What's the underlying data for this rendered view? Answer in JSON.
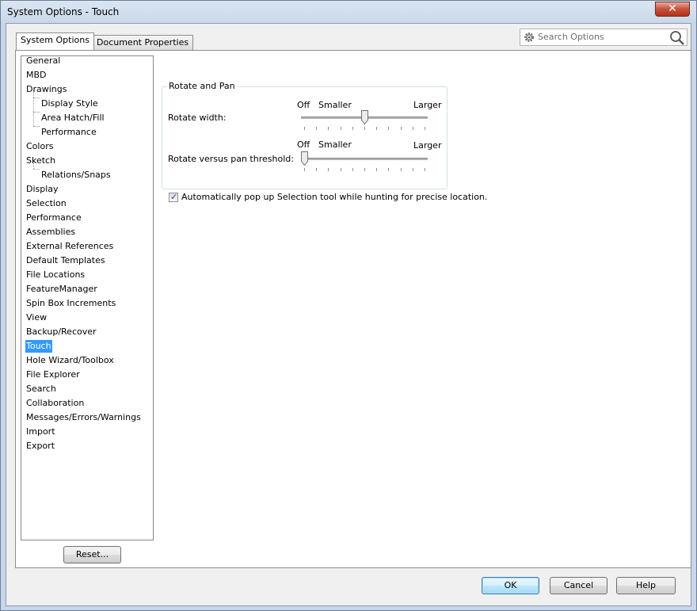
{
  "window": {
    "title": "System Options - Touch",
    "close_glyph": "✕"
  },
  "tabs": [
    {
      "label": "System Options",
      "active": true
    },
    {
      "label": "Document Properties",
      "active": false
    }
  ],
  "search": {
    "placeholder": "Search Options"
  },
  "tree": {
    "items": [
      {
        "label": "General"
      },
      {
        "label": "MBD"
      },
      {
        "label": "Drawings"
      },
      {
        "label": "Display Style",
        "child": true
      },
      {
        "label": "Area Hatch/Fill",
        "child": true
      },
      {
        "label": "Performance",
        "child": true
      },
      {
        "label": "Colors"
      },
      {
        "label": "Sketch"
      },
      {
        "label": "Relations/Snaps",
        "child": true
      },
      {
        "label": "Display"
      },
      {
        "label": "Selection"
      },
      {
        "label": "Performance"
      },
      {
        "label": "Assemblies"
      },
      {
        "label": "External References"
      },
      {
        "label": "Default Templates"
      },
      {
        "label": "File Locations"
      },
      {
        "label": "FeatureManager"
      },
      {
        "label": "Spin Box Increments"
      },
      {
        "label": "View"
      },
      {
        "label": "Backup/Recover"
      },
      {
        "label": "Touch",
        "selected": true
      },
      {
        "label": "Hole Wizard/Toolbox"
      },
      {
        "label": "File Explorer"
      },
      {
        "label": "Search"
      },
      {
        "label": "Collaboration"
      },
      {
        "label": "Messages/Errors/Warnings"
      },
      {
        "label": "Import"
      },
      {
        "label": "Export"
      }
    ]
  },
  "reset_label": "Reset...",
  "rotate_pan": {
    "group_title": "Rotate and Pan",
    "rotate_width": {
      "label": "Rotate width:",
      "off": "Off",
      "min": "Smaller",
      "max": "Larger",
      "value": 0.5
    },
    "threshold": {
      "label": "Rotate versus pan threshold:",
      "off": "Off",
      "min": "Smaller",
      "max": "Larger",
      "value": 0.0
    }
  },
  "auto_popup": {
    "checked": true,
    "label": "Automatically pop up Selection tool while hunting for precise location."
  },
  "buttons": {
    "ok": "OK",
    "cancel": "Cancel",
    "help": "Help"
  }
}
